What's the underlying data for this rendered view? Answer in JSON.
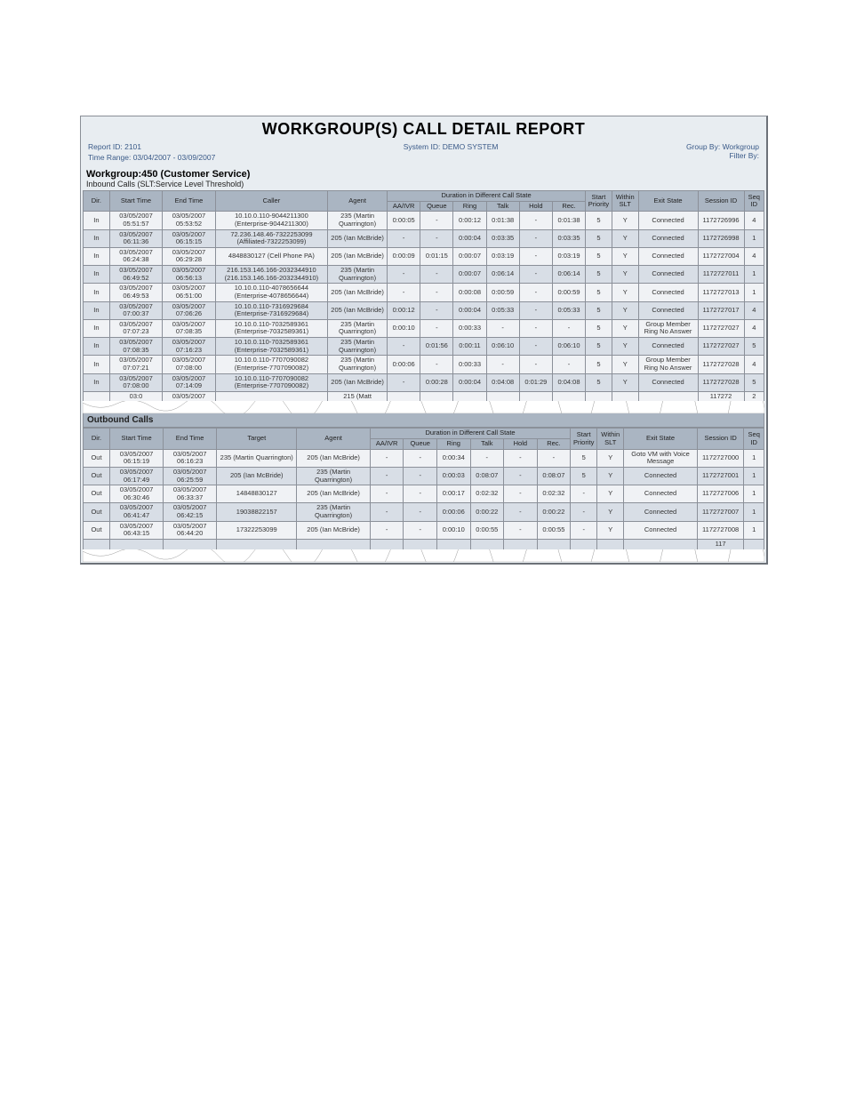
{
  "title": "WORKGROUP(S) CALL DETAIL REPORT",
  "reportId": "Report ID: 2101",
  "systemId": "System ID: DEMO SYSTEM",
  "groupBy": "Group By: Workgroup",
  "filterBy": "Filter By:",
  "timeRange": "Time Range: 03/04/2007 - 03/09/2007",
  "workgroup": "Workgroup:450 (Customer Service)",
  "inboundNote": "Inbound Calls (SLT:Service Level Threshold)",
  "outboundNote": "Outbound Calls",
  "cols": {
    "dir": "Dir.",
    "start": "Start Time",
    "end": "End Time",
    "caller": "Caller",
    "target": "Target",
    "agent": "Agent",
    "durGroup": "Duration in Different Call State",
    "aaivr": "AA/IVR",
    "queue": "Queue",
    "ring": "Ring",
    "talk": "Talk",
    "hold": "Hold",
    "rec": "Rec.",
    "startPri": "Start Priority",
    "slt": "Within SLT",
    "exit": "Exit State",
    "session": "Session ID",
    "seq": "Seq ID"
  },
  "inbound": [
    {
      "dir": "In",
      "start": "03/05/2007 05:51:57",
      "end": "03/05/2007 05:53:52",
      "caller": "10.10.0.110-9044211300 (Enterprise-9044211300)",
      "agent": "235 (Martin Quarrington)",
      "aa": "0:00:05",
      "queue": "-",
      "ring": "0:00:12",
      "talk": "0:01:38",
      "hold": "-",
      "rec": "0:01:38",
      "pri": "5",
      "slt": "Y",
      "exit": "Connected",
      "sess": "1172726996",
      "seq": "4"
    },
    {
      "dir": "In",
      "start": "03/05/2007 06:11:36",
      "end": "03/05/2007 06:15:15",
      "caller": "72.236.148.46-7322253099 (Affiliated-7322253099)",
      "agent": "205 (Ian McBride)",
      "aa": "-",
      "queue": "-",
      "ring": "0:00:04",
      "talk": "0:03:35",
      "hold": "-",
      "rec": "0:03:35",
      "pri": "5",
      "slt": "Y",
      "exit": "Connected",
      "sess": "1172726998",
      "seq": "1"
    },
    {
      "dir": "In",
      "start": "03/05/2007 06:24:38",
      "end": "03/05/2007 06:29:28",
      "caller": "4848830127 (Cell Phone PA)",
      "agent": "205 (Ian McBride)",
      "aa": "0:00:09",
      "queue": "0:01:15",
      "ring": "0:00:07",
      "talk": "0:03:19",
      "hold": "-",
      "rec": "0:03:19",
      "pri": "5",
      "slt": "Y",
      "exit": "Connected",
      "sess": "1172727004",
      "seq": "4"
    },
    {
      "dir": "In",
      "start": "03/05/2007 06:49:52",
      "end": "03/05/2007 06:56:13",
      "caller": "216.153.146.166-2032344910 (216.153.146.166-2032344910)",
      "agent": "235 (Martin Quarrington)",
      "aa": "-",
      "queue": "-",
      "ring": "0:00:07",
      "talk": "0:06:14",
      "hold": "-",
      "rec": "0:06:14",
      "pri": "5",
      "slt": "Y",
      "exit": "Connected",
      "sess": "1172727011",
      "seq": "1"
    },
    {
      "dir": "In",
      "start": "03/05/2007 06:49:53",
      "end": "03/05/2007 06:51:00",
      "caller": "10.10.0.110-4078656644 (Enterprise-4078656644)",
      "agent": "205 (Ian McBride)",
      "aa": "-",
      "queue": "-",
      "ring": "0:00:08",
      "talk": "0:00:59",
      "hold": "-",
      "rec": "0:00:59",
      "pri": "5",
      "slt": "Y",
      "exit": "Connected",
      "sess": "1172727013",
      "seq": "1"
    },
    {
      "dir": "In",
      "start": "03/05/2007 07:00:37",
      "end": "03/05/2007 07:06:26",
      "caller": "10.10.0.110-7316929684 (Enterprise-7316929684)",
      "agent": "205 (Ian McBride)",
      "aa": "0:00:12",
      "queue": "-",
      "ring": "0:00:04",
      "talk": "0:05:33",
      "hold": "-",
      "rec": "0:05:33",
      "pri": "5",
      "slt": "Y",
      "exit": "Connected",
      "sess": "1172727017",
      "seq": "4"
    },
    {
      "dir": "In",
      "start": "03/05/2007 07:07:23",
      "end": "03/05/2007 07:08:35",
      "caller": "10.10.0.110-7032589361 (Enterprise-7032589361)",
      "agent": "235 (Martin Quarrington)",
      "aa": "0:00:10",
      "queue": "-",
      "ring": "0:00:33",
      "talk": "-",
      "hold": "-",
      "rec": "-",
      "pri": "5",
      "slt": "Y",
      "exit": "Group Member Ring No Answer",
      "sess": "1172727027",
      "seq": "4"
    },
    {
      "dir": "In",
      "start": "03/05/2007 07:08:35",
      "end": "03/05/2007 07:16:23",
      "caller": "10.10.0.110-7032589361 (Enterprise-7032589361)",
      "agent": "235 (Martin Quarrington)",
      "aa": "-",
      "queue": "0:01:56",
      "ring": "0:00:11",
      "talk": "0:06:10",
      "hold": "-",
      "rec": "0:06:10",
      "pri": "5",
      "slt": "Y",
      "exit": "Connected",
      "sess": "1172727027",
      "seq": "5"
    },
    {
      "dir": "In",
      "start": "03/05/2007 07:07:21",
      "end": "03/05/2007 07:08:00",
      "caller": "10.10.0.110-7707090082 (Enterprise-7707090082)",
      "agent": "235 (Martin Quarrington)",
      "aa": "0:00:06",
      "queue": "-",
      "ring": "0:00:33",
      "talk": "-",
      "hold": "-",
      "rec": "-",
      "pri": "5",
      "slt": "Y",
      "exit": "Group Member Ring No Answer",
      "sess": "1172727028",
      "seq": "4"
    },
    {
      "dir": "In",
      "start": "03/05/2007 07:08:00",
      "end": "03/05/2007 07:14:09",
      "caller": "10.10.0.110-7707090082 (Enterprise-7707090082)",
      "agent": "205 (Ian McBride)",
      "aa": "-",
      "queue": "0:00:28",
      "ring": "0:00:04",
      "talk": "0:04:08",
      "hold": "0:01:29",
      "rec": "0:04:08",
      "pri": "5",
      "slt": "Y",
      "exit": "Connected",
      "sess": "1172727028",
      "seq": "5"
    }
  ],
  "inboundTorn": {
    "start": "03:0",
    "end": "03/05/2007",
    "agent": "215 (Matt",
    "seq": "2",
    "sess": "117272"
  },
  "outbound": [
    {
      "dir": "Out",
      "start": "03/05/2007 06:15:19",
      "end": "03/05/2007 06:16:23",
      "target": "235 (Martin Quarrington)",
      "agent": "205 (Ian McBride)",
      "aa": "-",
      "queue": "-",
      "ring": "0:00:34",
      "talk": "-",
      "hold": "-",
      "rec": "-",
      "pri": "5",
      "slt": "Y",
      "exit": "Goto VM with Voice Message",
      "sess": "1172727000",
      "seq": "1"
    },
    {
      "dir": "Out",
      "start": "03/05/2007 06:17:49",
      "end": "03/05/2007 06:25:59",
      "target": "205 (Ian McBride)",
      "agent": "235 (Martin Quarrington)",
      "aa": "-",
      "queue": "-",
      "ring": "0:00:03",
      "talk": "0:08:07",
      "hold": "-",
      "rec": "0:08:07",
      "pri": "5",
      "slt": "Y",
      "exit": "Connected",
      "sess": "1172727001",
      "seq": "1"
    },
    {
      "dir": "Out",
      "start": "03/05/2007 06:30:46",
      "end": "03/05/2007 06:33:37",
      "target": "14848830127",
      "agent": "205 (Ian McBride)",
      "aa": "-",
      "queue": "-",
      "ring": "0:00:17",
      "talk": "0:02:32",
      "hold": "-",
      "rec": "0:02:32",
      "pri": "-",
      "slt": "Y",
      "exit": "Connected",
      "sess": "1172727006",
      "seq": "1"
    },
    {
      "dir": "Out",
      "start": "03/05/2007 06:41:47",
      "end": "03/05/2007 06:42:15",
      "target": "19038822157",
      "agent": "235 (Martin Quarrington)",
      "aa": "-",
      "queue": "-",
      "ring": "0:00:06",
      "talk": "0:00:22",
      "hold": "-",
      "rec": "0:00:22",
      "pri": "-",
      "slt": "Y",
      "exit": "Connected",
      "sess": "1172727007",
      "seq": "1"
    },
    {
      "dir": "Out",
      "start": "03/05/2007 06:43:15",
      "end": "03/05/2007 06:44:20",
      "target": "17322253099",
      "agent": "205 (Ian McBride)",
      "aa": "-",
      "queue": "-",
      "ring": "0:00:10",
      "talk": "0:00:55",
      "hold": "-",
      "rec": "0:00:55",
      "pri": "-",
      "slt": "Y",
      "exit": "Connected",
      "sess": "1172727008",
      "seq": "1"
    }
  ],
  "outboundTorn": {
    "sess": "117"
  }
}
